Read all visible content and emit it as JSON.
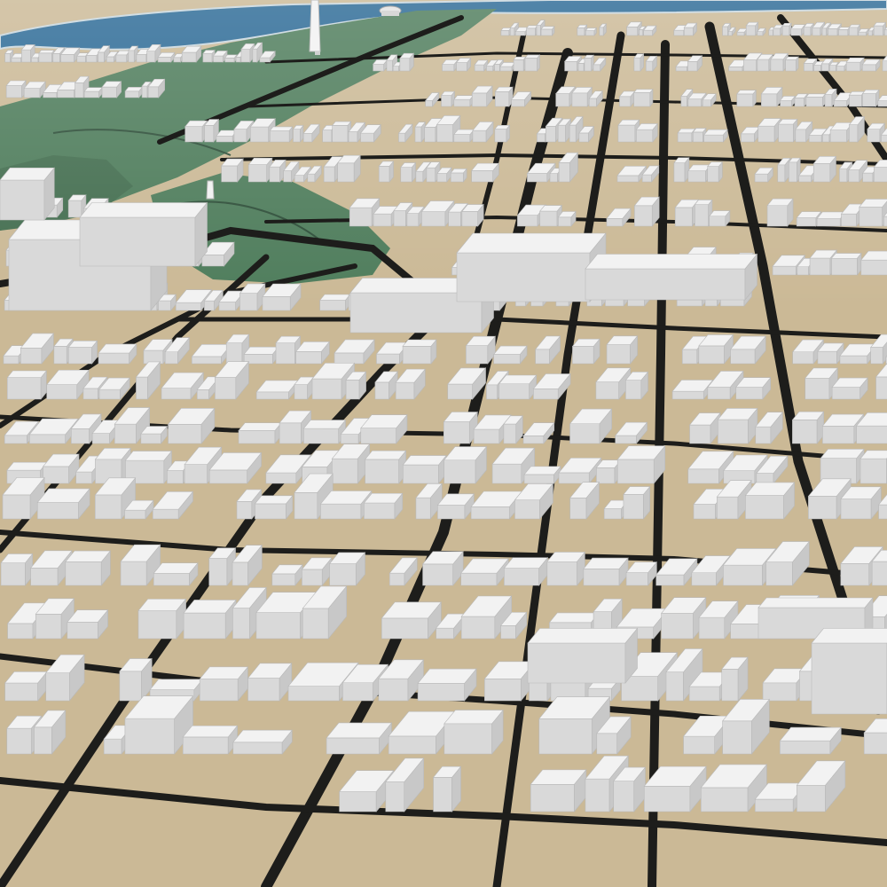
{
  "map": {
    "view": "3d-perspective-city",
    "colors": {
      "ground": "#cbb996",
      "ground_far": "#d6c6a4",
      "road": "#1d1d1b",
      "road_edge": "#6d665a",
      "water": "#2c6a96",
      "water_edge": "#c9d7de",
      "park": "#4f7d5c",
      "park_dark": "#456f51",
      "building_top": "#f2f2f2",
      "building_left": "#d9d9d9",
      "building_right": "#c8c8c8"
    },
    "layers": [
      "water",
      "park",
      "roads",
      "buildings"
    ],
    "landmarks": [
      "monument-obelisk",
      "domed-memorial"
    ]
  }
}
